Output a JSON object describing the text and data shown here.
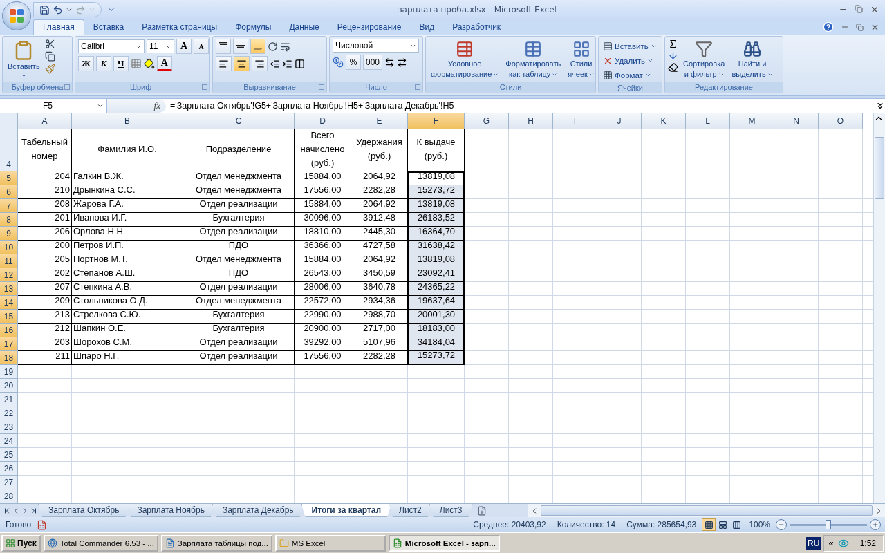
{
  "window": {
    "title": "зарплата проба.xlsx - Microsoft Excel"
  },
  "ribbon_tabs": [
    {
      "label": "Главная",
      "selected": true
    },
    {
      "label": "Вставка",
      "selected": false
    },
    {
      "label": "Разметка страницы",
      "selected": false
    },
    {
      "label": "Формулы",
      "selected": false
    },
    {
      "label": "Данные",
      "selected": false
    },
    {
      "label": "Рецензирование",
      "selected": false
    },
    {
      "label": "Вид",
      "selected": false
    },
    {
      "label": "Разработчик",
      "selected": false
    }
  ],
  "ribbon": {
    "clipboard": {
      "title": "Буфер обмена",
      "paste": "Вставить"
    },
    "font": {
      "title": "Шрифт",
      "font_name": "Calibri",
      "font_size": "11",
      "grow": "A",
      "shrink": "A",
      "bold": "Ж",
      "italic": "К",
      "underline": "Ч",
      "font_color": "A"
    },
    "alignment": {
      "title": "Выравнивание",
      "vertical": [
        {
          "selected": false
        },
        {
          "selected": false
        },
        {
          "selected": true
        }
      ],
      "horizontal": [
        {
          "selected": false
        },
        {
          "selected": true
        },
        {
          "selected": false
        }
      ]
    },
    "number": {
      "title": "Число",
      "format": "Числовой",
      "percent": "%",
      "thousands": "000"
    },
    "styles": {
      "title": "Стили",
      "buttons": [
        {
          "lines": [
            "Условное",
            "форматирование"
          ]
        },
        {
          "lines": [
            "Форматировать",
            "как таблицу"
          ]
        },
        {
          "lines": [
            "Стили",
            "ячеек"
          ]
        }
      ]
    },
    "cells": {
      "title": "Ячейки",
      "buttons": [
        "Вставить",
        "Удалить",
        "Формат"
      ]
    },
    "editing": {
      "title": "Редактирование",
      "buttons": [
        {
          "lines": [
            "Сортировка",
            "и фильтр"
          ]
        },
        {
          "lines": [
            "Найти и",
            "выделить"
          ]
        }
      ]
    }
  },
  "formula_bar": {
    "name_box": "F5",
    "function_label": "fx",
    "formula": "='Зарплата Октябрь'!G5+'Зарплата Ноябрь'!H5+'Зарплата Декабрь'!H5"
  },
  "columns": [
    {
      "label": "A",
      "selected": false
    },
    {
      "label": "B",
      "selected": false
    },
    {
      "label": "C",
      "selected": false
    },
    {
      "label": "D",
      "selected": false
    },
    {
      "label": "E",
      "selected": false
    },
    {
      "label": "F",
      "selected": true
    },
    {
      "label": "G",
      "selected": false
    },
    {
      "label": "H",
      "selected": false
    },
    {
      "label": "I",
      "selected": false
    },
    {
      "label": "J",
      "selected": false
    },
    {
      "label": "K",
      "selected": false
    },
    {
      "label": "L",
      "selected": false
    },
    {
      "label": "M",
      "selected": false
    },
    {
      "label": "N",
      "selected": false
    },
    {
      "label": "O",
      "selected": false
    }
  ],
  "rows": [
    {
      "number": "4",
      "kind": "header",
      "selected": false,
      "cells": [
        "Табельный номер",
        "Фамилия И.О.",
        "Подразделение",
        "Всего начислено (руб.)",
        "Удержания (руб.)",
        "К выдаче (руб.)"
      ]
    },
    {
      "number": "5",
      "kind": "data",
      "selected": true,
      "cells": [
        "204",
        "Галкин В.Ж.",
        "Отдел менеджмента",
        "15884,00",
        "2064,92",
        "13819,08"
      ]
    },
    {
      "number": "6",
      "kind": "data",
      "selected": true,
      "cells": [
        "210",
        "Дрынкина С.С.",
        "Отдел менеджмента",
        "17556,00",
        "2282,28",
        "15273,72"
      ]
    },
    {
      "number": "7",
      "kind": "data",
      "selected": true,
      "cells": [
        "208",
        "Жарова Г.А.",
        "Отдел реализации",
        "15884,00",
        "2064,92",
        "13819,08"
      ]
    },
    {
      "number": "8",
      "kind": "data",
      "selected": true,
      "cells": [
        "201",
        "Иванова И.Г.",
        "Бухгалтерия",
        "30096,00",
        "3912,48",
        "26183,52"
      ]
    },
    {
      "number": "9",
      "kind": "data",
      "selected": true,
      "cells": [
        "206",
        "Орлова Н.Н.",
        "Отдел реализации",
        "18810,00",
        "2445,30",
        "16364,70"
      ]
    },
    {
      "number": "10",
      "kind": "data",
      "selected": true,
      "cells": [
        "200",
        "Петров И.П.",
        "ПДО",
        "36366,00",
        "4727,58",
        "31638,42"
      ]
    },
    {
      "number": "11",
      "kind": "data",
      "selected": true,
      "cells": [
        "205",
        "Портнов М.Т.",
        "Отдел менеджмента",
        "15884,00",
        "2064,92",
        "13819,08"
      ]
    },
    {
      "number": "12",
      "kind": "data",
      "selected": true,
      "cells": [
        "202",
        "Степанов А.Ш.",
        "ПДО",
        "26543,00",
        "3450,59",
        "23092,41"
      ]
    },
    {
      "number": "13",
      "kind": "data",
      "selected": true,
      "cells": [
        "207",
        "Степкина А.В.",
        "Отдел реализации",
        "28006,00",
        "3640,78",
        "24365,22"
      ]
    },
    {
      "number": "14",
      "kind": "data",
      "selected": true,
      "cells": [
        "209",
        "Стольникова О.Д.",
        "Отдел менеджмента",
        "22572,00",
        "2934,36",
        "19637,64"
      ]
    },
    {
      "number": "15",
      "kind": "data",
      "selected": true,
      "cells": [
        "213",
        "Стрелкова С.Ю.",
        "Бухгалтерия",
        "22990,00",
        "2988,70",
        "20001,30"
      ]
    },
    {
      "number": "16",
      "kind": "data",
      "selected": true,
      "cells": [
        "212",
        "Шапкин О.Е.",
        "Бухгалтерия",
        "20900,00",
        "2717,00",
        "18183,00"
      ]
    },
    {
      "number": "17",
      "kind": "data",
      "selected": true,
      "cells": [
        "203",
        "Шорохов С.М.",
        "Отдел реализации",
        "39292,00",
        "5107,96",
        "34184,04"
      ]
    },
    {
      "number": "18",
      "kind": "data",
      "selected": true,
      "cells": [
        "211",
        "Шпаро Н.Г.",
        "Отдел реализации",
        "17556,00",
        "2282,28",
        "15273,72"
      ]
    },
    {
      "number": "19",
      "kind": "empty",
      "selected": false
    },
    {
      "number": "20",
      "kind": "empty",
      "selected": false
    },
    {
      "number": "21",
      "kind": "empty",
      "selected": false
    },
    {
      "number": "22",
      "kind": "empty",
      "selected": false
    },
    {
      "number": "23",
      "kind": "empty",
      "selected": false
    },
    {
      "number": "24",
      "kind": "empty",
      "selected": false
    },
    {
      "number": "25",
      "kind": "empty",
      "selected": false
    },
    {
      "number": "26",
      "kind": "empty",
      "selected": false
    },
    {
      "number": "27",
      "kind": "empty",
      "selected": false
    },
    {
      "number": "28",
      "kind": "empty",
      "selected": false
    }
  ],
  "sheet_tabs": [
    {
      "label": "Зарплата Октябрь",
      "selected": false
    },
    {
      "label": "Зарплата Ноябрь",
      "selected": false
    },
    {
      "label": "Зарплата Декабрь",
      "selected": false
    },
    {
      "label": "Итоги за квартал",
      "selected": true
    },
    {
      "label": "Лист2",
      "selected": false
    },
    {
      "label": "Лист3",
      "selected": false
    }
  ],
  "status_bar": {
    "state": "Готово",
    "average": "Среднее: 20403,92",
    "count": "Количество: 14",
    "sum": "Сумма: 285654,93",
    "views": [
      {
        "selected": true
      },
      {
        "selected": false
      },
      {
        "selected": false
      }
    ],
    "zoom": "100%",
    "zoom_level": {
      "level": 0.5
    }
  },
  "taskbar": {
    "start": "Пуск",
    "tasks": [
      {
        "label": "Total Commander 6.53 - ...",
        "active": false
      },
      {
        "label": "Зарплата таблицы под...",
        "active": false
      },
      {
        "label": "MS Excel",
        "active": false
      },
      {
        "label": "Microsoft Excel - зарп...",
        "active": true
      }
    ],
    "language": "RU",
    "tray_toggle": "«",
    "clock": "1:52"
  }
}
